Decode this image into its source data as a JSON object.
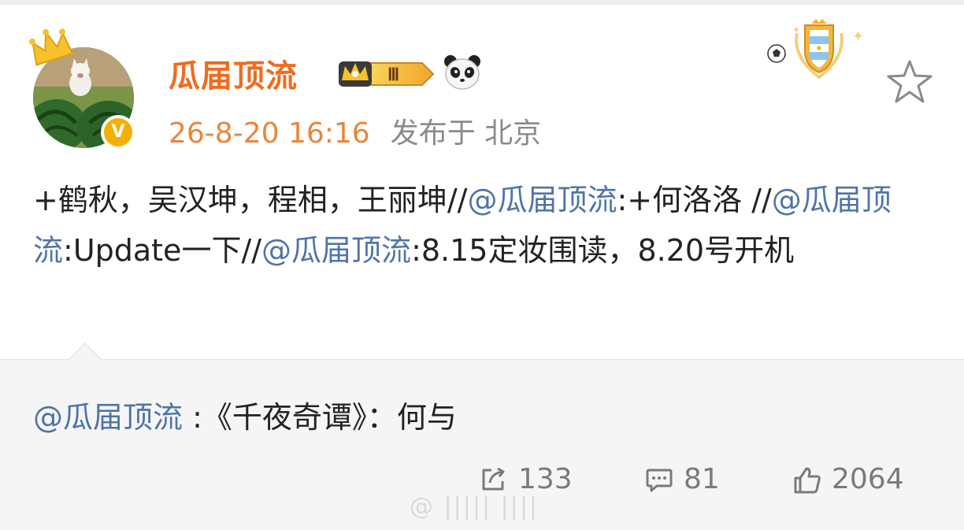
{
  "post": {
    "username": "瓜届顶流",
    "level_badge": "Ⅲ",
    "timestamp": "26-8-20 16:16",
    "location": "发布于 北京",
    "content": [
      {
        "text": "+鹤秋，吴汉坤，程相，王丽坤//",
        "type": "text"
      },
      {
        "text": "@瓜届顶流",
        "type": "mention"
      },
      {
        "text": ":+何洛洛 //",
        "type": "text"
      },
      {
        "text": "@瓜届顶流",
        "type": "mention"
      },
      {
        "text": ":Update一下//",
        "type": "text"
      },
      {
        "text": "@瓜届顶流",
        "type": "mention"
      },
      {
        "text": ":8.15定妆围读，8.20号开机",
        "type": "text"
      }
    ],
    "icons": {
      "crown": "crown-icon",
      "verified": "verified-icon",
      "panda": "panda-icon",
      "star": "star-icon"
    },
    "colors": {
      "username": "#f06b1f",
      "timestamp": "#e8863a",
      "mention": "#4f74a8",
      "verified": "#f4b000"
    }
  },
  "repost": {
    "mention": "@瓜届顶流",
    "text": " :《千夜奇谭》：何与"
  },
  "actions": {
    "share_count": "133",
    "comment_count": "81",
    "like_count": "2064"
  },
  "watermark": "@ ||||| ||||"
}
